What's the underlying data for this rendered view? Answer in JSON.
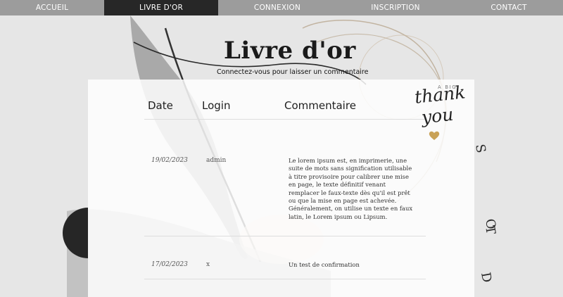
{
  "nav": {
    "items": [
      {
        "label": "ACCUEIL"
      },
      {
        "label": "LIVRE D'OR"
      },
      {
        "label": "CONNEXION"
      },
      {
        "label": "INSCRIPTION"
      },
      {
        "label": "CONTACT"
      }
    ],
    "active_index": 1
  },
  "header": {
    "title": "Livre d'or",
    "subtitle": "Connectez-vous pour laisser un commentaire"
  },
  "badge": {
    "small": "A BIG",
    "line1": "thank",
    "line2": "you",
    "heart_color": "#c9a257"
  },
  "table": {
    "headers": {
      "date": "Date",
      "login": "Login",
      "comment": "Commentaire"
    },
    "rows": [
      {
        "date": "19/02/2023",
        "login": "admin",
        "comment": "Le lorem ipsum est, en imprimerie, une suite de mots sans signification utilisable à  titre provisoire pour calibrer une mise en page, le texte définitif venant remplacer le faux-texte dès qu'il est prêt ou que la mise en page est achevée. Généralement, on utilise un texte en faux latin, le Lorem ipsum ou Lipsum."
      },
      {
        "date": "17/02/2023",
        "login": "x",
        "comment": "Un test de confirmation"
      }
    ]
  },
  "colors": {
    "navbar": "#9c9c9c",
    "navbar_active": "#272727",
    "page_bg": "#e6e6e6"
  }
}
